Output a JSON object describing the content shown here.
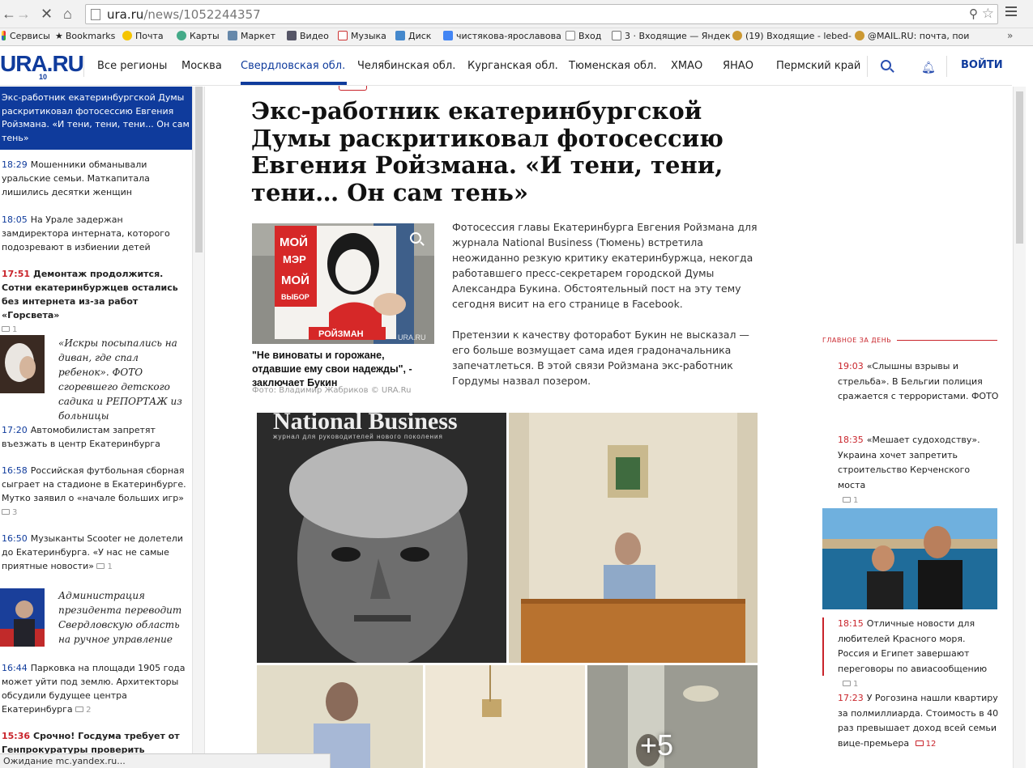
{
  "browser": {
    "url_domain": "ura.ru",
    "url_path": "/news/1052244357",
    "bookmarks": [
      "Сервисы",
      "Bookmarks",
      "Почта",
      "Карты",
      "Маркет",
      "Видео",
      "Музыка",
      "Диск",
      "чистякова-ярославова",
      "Вход",
      "3 · Входящие — Яндек",
      "(19) Входящие - lebed-",
      "@MAIL.RU: почта, пои"
    ],
    "bookmarks_more": "»",
    "status_text": "Ожидание mc.yandex.ru..."
  },
  "header": {
    "logo": "URA.RU",
    "logo_sub": "10",
    "regions": [
      "Все регионы",
      "Москва",
      "Свердловская обл.",
      "Челябинская обл.",
      "Курганская обл.",
      "Тюменская обл.",
      "ХМАО",
      "ЯНАО",
      "Пермский край"
    ],
    "active_region": "Свердловская обл.",
    "login": "ВОЙТИ"
  },
  "feed": {
    "highlight": "Экс-работник екатеринбургской Думы раскритиковал фотосессию Евгения Ройзмана. «И тени, тени, тени... Он сам тень»",
    "items": [
      {
        "time": "18:29",
        "text": "Мошенники обманывали уральские семьи. Маткапитала лишились десятки женщин"
      },
      {
        "time": "18:05",
        "text": "На Урале задержан замдиректора интерната, которого подозревают в избиении детей"
      },
      {
        "time": "17:51",
        "text": "Демонтаж продолжится. Сотни екатеринбуржцев остались без интернета из-за работ «Горсвета»",
        "comments": "1"
      },
      {
        "text": "«Искры посыпались на диван, где спал ребенок». ФОТО сгоревшего детского садика и РЕПОРТАЖ из больницы"
      },
      {
        "time": "17:20",
        "text": "Автомобилистам запретят въезжать в центр Екатеринбурга"
      },
      {
        "time": "16:58",
        "text": "Российская футбольная сборная сыграет на стадионе в Екатеринбурге. Мутко заявил о «начале больших игр»",
        "comments": "3"
      },
      {
        "time": "16:50",
        "text": "Музыканты Scooter не долетели до Екатеринбурга. «У нас не самые приятные новости»",
        "comments": "1"
      },
      {
        "text": "Администрация президента переводит Свердловскую область на ручное управление"
      },
      {
        "time": "16:44",
        "text": "Парковка на площади 1905 года может уйти под землю. Архитекторы обсудили будущее центра Екатеринбурга",
        "comments": "2"
      },
      {
        "time": "15:36",
        "text": "Срочно! Госдума требует от Генпрокуратуры проверить"
      }
    ]
  },
  "article": {
    "headline": "Экс-работник екатеринбургской Думы раскритиковал фотосессию Евгения Ройзмана. «И тени, тени, тени… Он сам тень»",
    "photo_sign": [
      "МОЙ",
      "МЭР",
      "МОЙ",
      "ВЫБОР"
    ],
    "photo_name": "РОЙЗМАН",
    "photo_watermark": "URA.RU",
    "caption": "\"Не виноваты и горожане, отдавшие ему свои надежды\", - заключает Букин",
    "photo_credit": "Фото: Владимир Жабриков © URA.Ru",
    "paragraphs": [
      "Фотосессия главы Екатеринбурга Евгения Ройзмана для журнала National Business (Тюмень) встретила неожиданно резкую критику екатеринбуржца, некогда работавшего пресс-секретарем городской Думы Александра Букина. Обстоятельный пост на эту тему сегодня висит на его странице в Facebook.",
      "Претензии к качеству фоторабот Букин не высказал — его больше возмущает сама идея градоначальника запечатлеться. В этой связи Ройзмана экс-работник Гордумы назвал позером."
    ],
    "magazine_title": "National Business",
    "magazine_sub": "журнал для руководителей нового поколения",
    "more_photos": "+5"
  },
  "sidebar_right": {
    "label": "Главное за день",
    "items": [
      {
        "time": "19:03",
        "text": "«Слышны взрывы и стрельба». В Бельгии полиция сражается с террористами. ФОТО"
      },
      {
        "time": "18:35",
        "text": "«Мешает судоходству». Украина хочет запретить строительство Керченского моста",
        "comments": "1"
      },
      {
        "time": "18:15",
        "text": "Отличные новости для любителей Красного моря. Россия и Египет завершают переговоры по авиасообщению",
        "comments": "1"
      },
      {
        "time": "17:23",
        "text": "У Рогозина нашли квартиру за полмиллиарда. Стоимость в 40 раз превышает доход всей семьи вице-премьера",
        "comments": "12"
      }
    ]
  },
  "colors": {
    "brand": "#0f3b9c",
    "accent_red": "#c9242b"
  }
}
